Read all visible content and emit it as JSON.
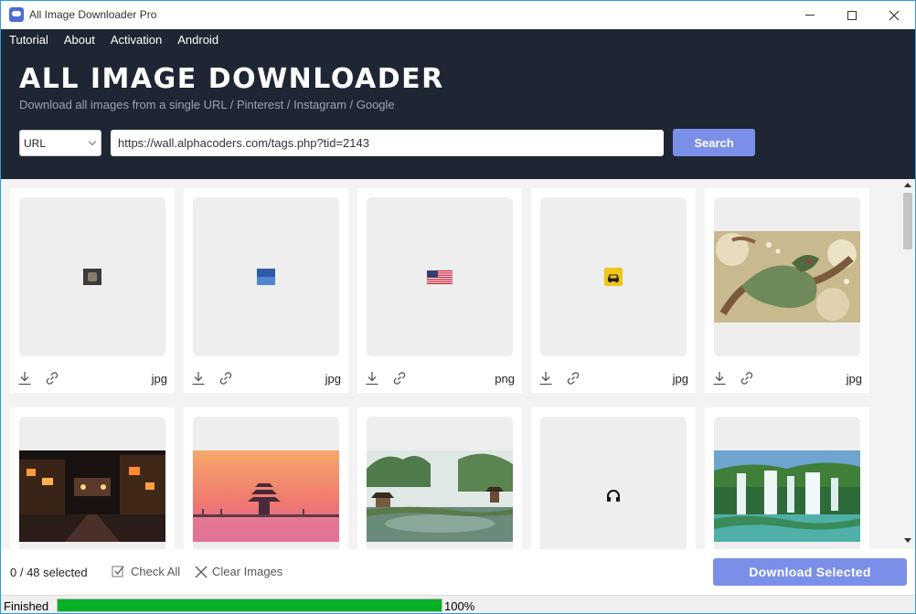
{
  "window": {
    "title": "All Image Downloader Pro"
  },
  "menu": {
    "items": [
      "Tutorial",
      "About",
      "Activation",
      "Android"
    ]
  },
  "header": {
    "title": "ALL IMAGE DOWNLOADER",
    "subtitle": "Download all images from a single URL / Pinterest / Instagram / Google",
    "source_selected": "URL",
    "url_value": "https://wall.alphacoders.com/tags.php?tid=2143",
    "search_label": "Search"
  },
  "images": [
    {
      "ext": "jpg",
      "thumb": "tiny-dark-square"
    },
    {
      "ext": "jpg",
      "thumb": "tiny-blue-square"
    },
    {
      "ext": "png",
      "thumb": "us-flag"
    },
    {
      "ext": "jpg",
      "thumb": "yellow-car-icon"
    },
    {
      "ext": "jpg",
      "thumb": "dragon-painting"
    },
    {
      "ext": "",
      "thumb": "night-street"
    },
    {
      "ext": "",
      "thumb": "pagoda-sunset"
    },
    {
      "ext": "",
      "thumb": "chinese-garden"
    },
    {
      "ext": "",
      "thumb": "headset-icon"
    },
    {
      "ext": "",
      "thumb": "waterfall"
    }
  ],
  "footer": {
    "selection": "0 / 48 selected",
    "check_all": "Check All",
    "clear_images": "Clear Images",
    "download_selected": "Download Selected"
  },
  "status": {
    "text": "Finished",
    "progress": 100,
    "progress_label": "100%"
  },
  "colors": {
    "header_bg": "#1f2633",
    "accent": "#7b8fe8",
    "progress": "#06b025"
  }
}
